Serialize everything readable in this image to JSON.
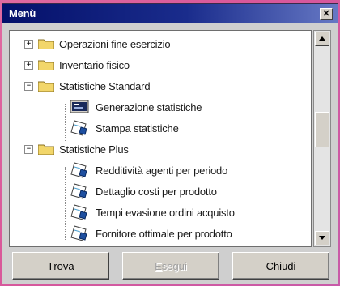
{
  "window": {
    "title": "Menù",
    "close_label": "✕"
  },
  "tree": {
    "items": [
      {
        "label": "Operazioni fine esercizio",
        "kind": "folder",
        "expander": "+"
      },
      {
        "label": "Inventario fisico",
        "kind": "folder",
        "expander": "+"
      },
      {
        "label": "Statistiche Standard",
        "kind": "folder",
        "expander": "−"
      },
      {
        "label": "Generazione statistiche",
        "kind": "screen"
      },
      {
        "label": "Stampa statistiche",
        "kind": "report"
      },
      {
        "label": "Statistiche Plus",
        "kind": "folder",
        "expander": "−"
      },
      {
        "label": "Redditività agenti per periodo",
        "kind": "report"
      },
      {
        "label": "Dettaglio costi per prodotto",
        "kind": "report"
      },
      {
        "label": "Tempi evasione ordini acquisto",
        "kind": "report"
      },
      {
        "label": "Fornitore ottimale per prodotto",
        "kind": "report"
      }
    ]
  },
  "buttons": {
    "trova": {
      "first": "T",
      "rest": "rova"
    },
    "esegui": {
      "first": "E",
      "rest": "segui"
    },
    "chiudi": {
      "first": "C",
      "rest": "hiudi"
    }
  },
  "colors": {
    "titlebar_start": "#04106a",
    "titlebar_end": "#6678c4",
    "folder": "#f2d66a",
    "background": "#d9589a"
  }
}
